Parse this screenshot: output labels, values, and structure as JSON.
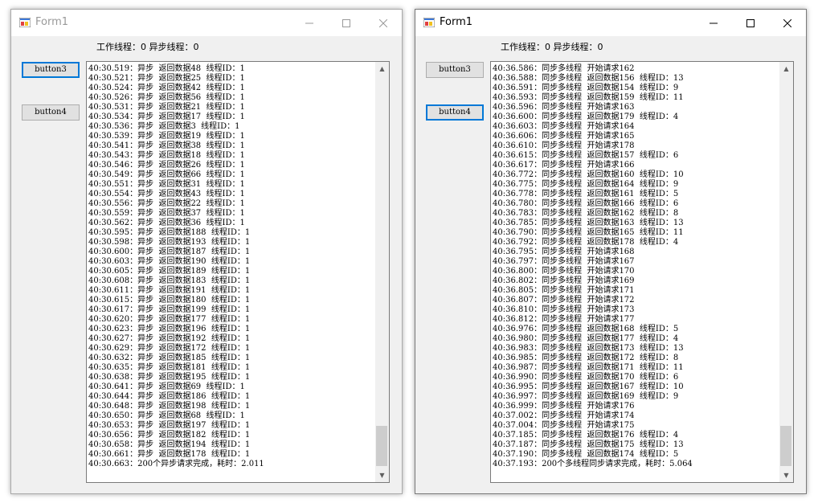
{
  "windows": [
    {
      "title": "Form1",
      "status": "工作线程：0 异步线程：0",
      "button3_label": "button3",
      "button4_label": "button4",
      "lines": [
        "40:30.519：异步  返回数据48  线程ID：1",
        "40:30.521：异步  返回数据25  线程ID：1",
        "40:30.524：异步  返回数据42  线程ID：1",
        "40:30.526：异步  返回数据56  线程ID：1",
        "40:30.531：异步  返回数据21  线程ID：1",
        "40:30.534：异步  返回数据17  线程ID：1",
        "40:30.536：异步  返回数据3  线程ID：1",
        "40:30.539：异步  返回数据19  线程ID：1",
        "40:30.541：异步  返回数据38  线程ID：1",
        "40:30.543：异步  返回数据18  线程ID：1",
        "40:30.546：异步  返回数据26  线程ID：1",
        "40:30.549：异步  返回数据66  线程ID：1",
        "40:30.551：异步  返回数据31  线程ID：1",
        "40:30.554：异步  返回数据43  线程ID：1",
        "40:30.556：异步  返回数据22  线程ID：1",
        "40:30.559：异步  返回数据37  线程ID：1",
        "40:30.562：异步  返回数据36  线程ID：1",
        "40:30.595：异步  返回数据188  线程ID：1",
        "40:30.598：异步  返回数据193  线程ID：1",
        "40:30.600：异步  返回数据187  线程ID：1",
        "40:30.603：异步  返回数据190  线程ID：1",
        "40:30.605：异步  返回数据189  线程ID：1",
        "40:30.608：异步  返回数据183  线程ID：1",
        "40:30.611：异步  返回数据191  线程ID：1",
        "40:30.615：异步  返回数据180  线程ID：1",
        "40:30.617：异步  返回数据199  线程ID：1",
        "40:30.620：异步  返回数据177  线程ID：1",
        "40:30.623：异步  返回数据196  线程ID：1",
        "40:30.627：异步  返回数据192  线程ID：1",
        "40:30.629：异步  返回数据172  线程ID：1",
        "40:30.632：异步  返回数据185  线程ID：1",
        "40:30.635：异步  返回数据181  线程ID：1",
        "40:30.638：异步  返回数据195  线程ID：1",
        "40:30.641：异步  返回数据69  线程ID：1",
        "40:30.644：异步  返回数据186  线程ID：1",
        "40:30.648：异步  返回数据198  线程ID：1",
        "40:30.650：异步  返回数据68  线程ID：1",
        "40:30.653：异步  返回数据197  线程ID：1",
        "40:30.656：异步  返回数据182  线程ID：1",
        "40:30.658：异步  返回数据194  线程ID：1",
        "40:30.661：异步  返回数据178  线程ID：1",
        "40:30.663：200个异步请求完成，耗时：2.011"
      ]
    },
    {
      "title": "Form1",
      "status": "工作线程：0 异步线程：0",
      "button3_label": "button3",
      "button4_label": "button4",
      "lines": [
        "40:36.586：同步多线程  开始请求162",
        "40:36.588：同步多线程  返回数据156  线程ID：13",
        "40:36.591：同步多线程  返回数据154  线程ID：9",
        "40:36.593：同步多线程  返回数据159  线程ID：11",
        "40:36.596：同步多线程  开始请求163",
        "40:36.600：同步多线程  返回数据179  线程ID：4",
        "40:36.603：同步多线程  开始请求164",
        "40:36.606：同步多线程  开始请求165",
        "40:36.610：同步多线程  开始请求178",
        "40:36.615：同步多线程  返回数据157  线程ID：6",
        "40:36.617：同步多线程  开始请求166",
        "40:36.772：同步多线程  返回数据160  线程ID：10",
        "40:36.775：同步多线程  返回数据164  线程ID：9",
        "40:36.778：同步多线程  返回数据161  线程ID：5",
        "40:36.780：同步多线程  返回数据166  线程ID：6",
        "40:36.783：同步多线程  返回数据162  线程ID：8",
        "40:36.785：同步多线程  返回数据163  线程ID：13",
        "40:36.790：同步多线程  返回数据165  线程ID：11",
        "40:36.792：同步多线程  返回数据178  线程ID：4",
        "40:36.795：同步多线程  开始请求168",
        "40:36.797：同步多线程  开始请求167",
        "40:36.800：同步多线程  开始请求170",
        "40:36.802：同步多线程  开始请求169",
        "40:36.805：同步多线程  开始请求171",
        "40:36.807：同步多线程  开始请求172",
        "40:36.810：同步多线程  开始请求173",
        "40:36.812：同步多线程  开始请求177",
        "40:36.976：同步多线程  返回数据168  线程ID：5",
        "40:36.980：同步多线程  返回数据177  线程ID：4",
        "40:36.983：同步多线程  返回数据173  线程ID：13",
        "40:36.985：同步多线程  返回数据172  线程ID：8",
        "40:36.987：同步多线程  返回数据171  线程ID：11",
        "40:36.990：同步多线程  返回数据170  线程ID：6",
        "40:36.995：同步多线程  返回数据167  线程ID：10",
        "40:36.997：同步多线程  返回数据169  线程ID：9",
        "40:36.999：同步多线程  开始请求176",
        "40:37.002：同步多线程  开始请求174",
        "40:37.004：同步多线程  开始请求175",
        "40:37.185：同步多线程  返回数据176  线程ID：4",
        "40:37.187：同步多线程  返回数据175  线程ID：13",
        "40:37.190：同步多线程  返回数据174  线程ID：5",
        "40:37.193：200个多线程同步请求完成，耗时：5.064"
      ]
    }
  ]
}
